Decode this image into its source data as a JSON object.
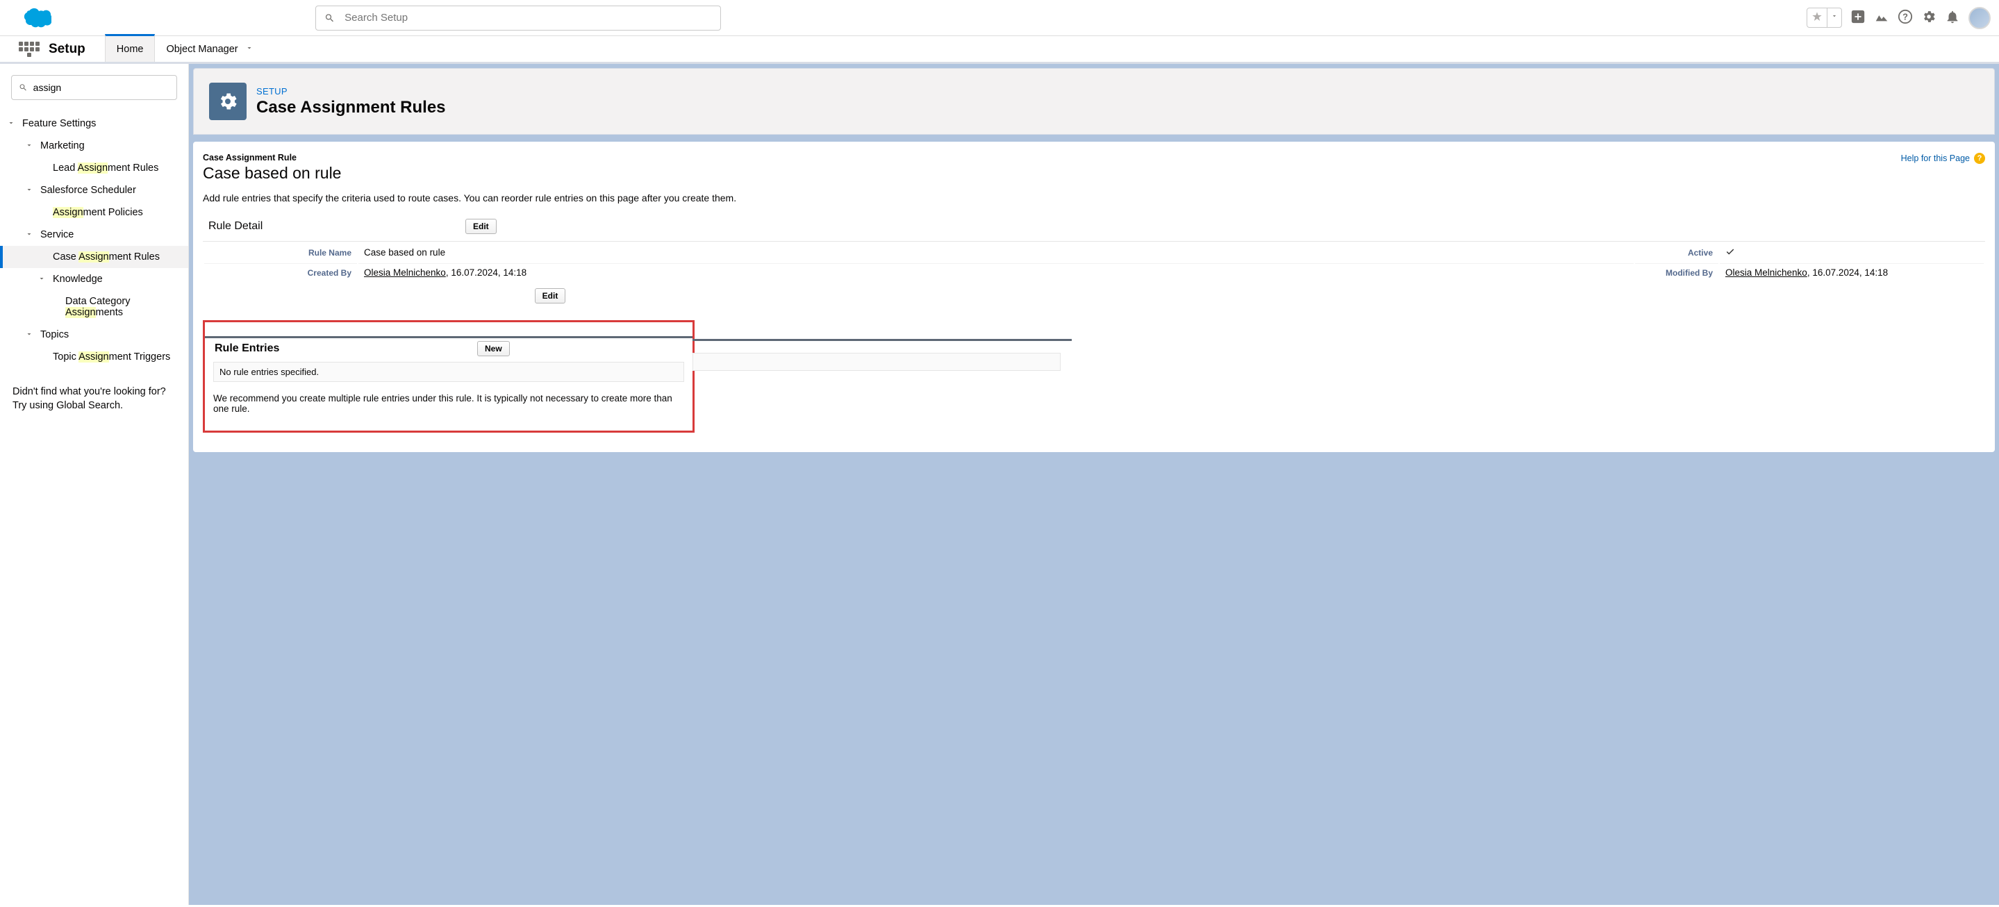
{
  "header": {
    "search_placeholder": "Search Setup"
  },
  "context": {
    "app_name": "Setup",
    "tabs": [
      {
        "label": "Home"
      },
      {
        "label": "Object Manager"
      }
    ]
  },
  "sidebar": {
    "filter_value": "assign",
    "tree": {
      "root_label": "Feature Settings",
      "groups": [
        {
          "label": "Marketing",
          "items": [
            {
              "pre": "Lead ",
              "hl": "Assign",
              "post": "ment Rules"
            }
          ]
        },
        {
          "label": "Salesforce Scheduler",
          "items": [
            {
              "pre": "",
              "hl": "Assign",
              "post": "ment Policies"
            }
          ]
        },
        {
          "label": "Service",
          "items": [
            {
              "pre": "Case ",
              "hl": "Assign",
              "post": "ment Rules",
              "selected": true
            }
          ],
          "subgroups": [
            {
              "label": "Knowledge",
              "items": [
                {
                  "pre": "Data Category ",
                  "hl": "Assign",
                  "post": "ments"
                }
              ]
            }
          ]
        },
        {
          "label": "Topics",
          "items": [
            {
              "pre": "Topic ",
              "hl": "Assign",
              "post": "ment Triggers"
            }
          ]
        }
      ]
    },
    "footer_line1": "Didn't find what you're looking for?",
    "footer_line2": "Try using Global Search."
  },
  "page": {
    "crumb": "SETUP",
    "title": "Case Assignment Rules",
    "object_label": "Case Assignment Rule",
    "object_name": "Case based on rule",
    "help_label": "Help for this Page",
    "description": "Add rule entries that specify the criteria used to route cases. You can reorder rule entries on this page after you create them.",
    "rule_detail": {
      "section_title": "Rule Detail",
      "edit_label": "Edit",
      "rule_name_label": "Rule Name",
      "rule_name_value": "Case based on rule",
      "active_label": "Active",
      "created_by_label": "Created By",
      "created_by_name": "Olesia Melnichenko",
      "created_by_date": ", 16.07.2024, 14:18",
      "modified_by_label": "Modified By",
      "modified_by_name": "Olesia Melnichenko",
      "modified_by_date": ", 16.07.2024, 14:18"
    },
    "rule_entries": {
      "section_title": "Rule Entries",
      "new_label": "New",
      "empty_text": "No rule entries specified.",
      "recommendation": "We recommend you create multiple rule entries under this rule. It is typically not necessary to create more than one rule."
    }
  }
}
